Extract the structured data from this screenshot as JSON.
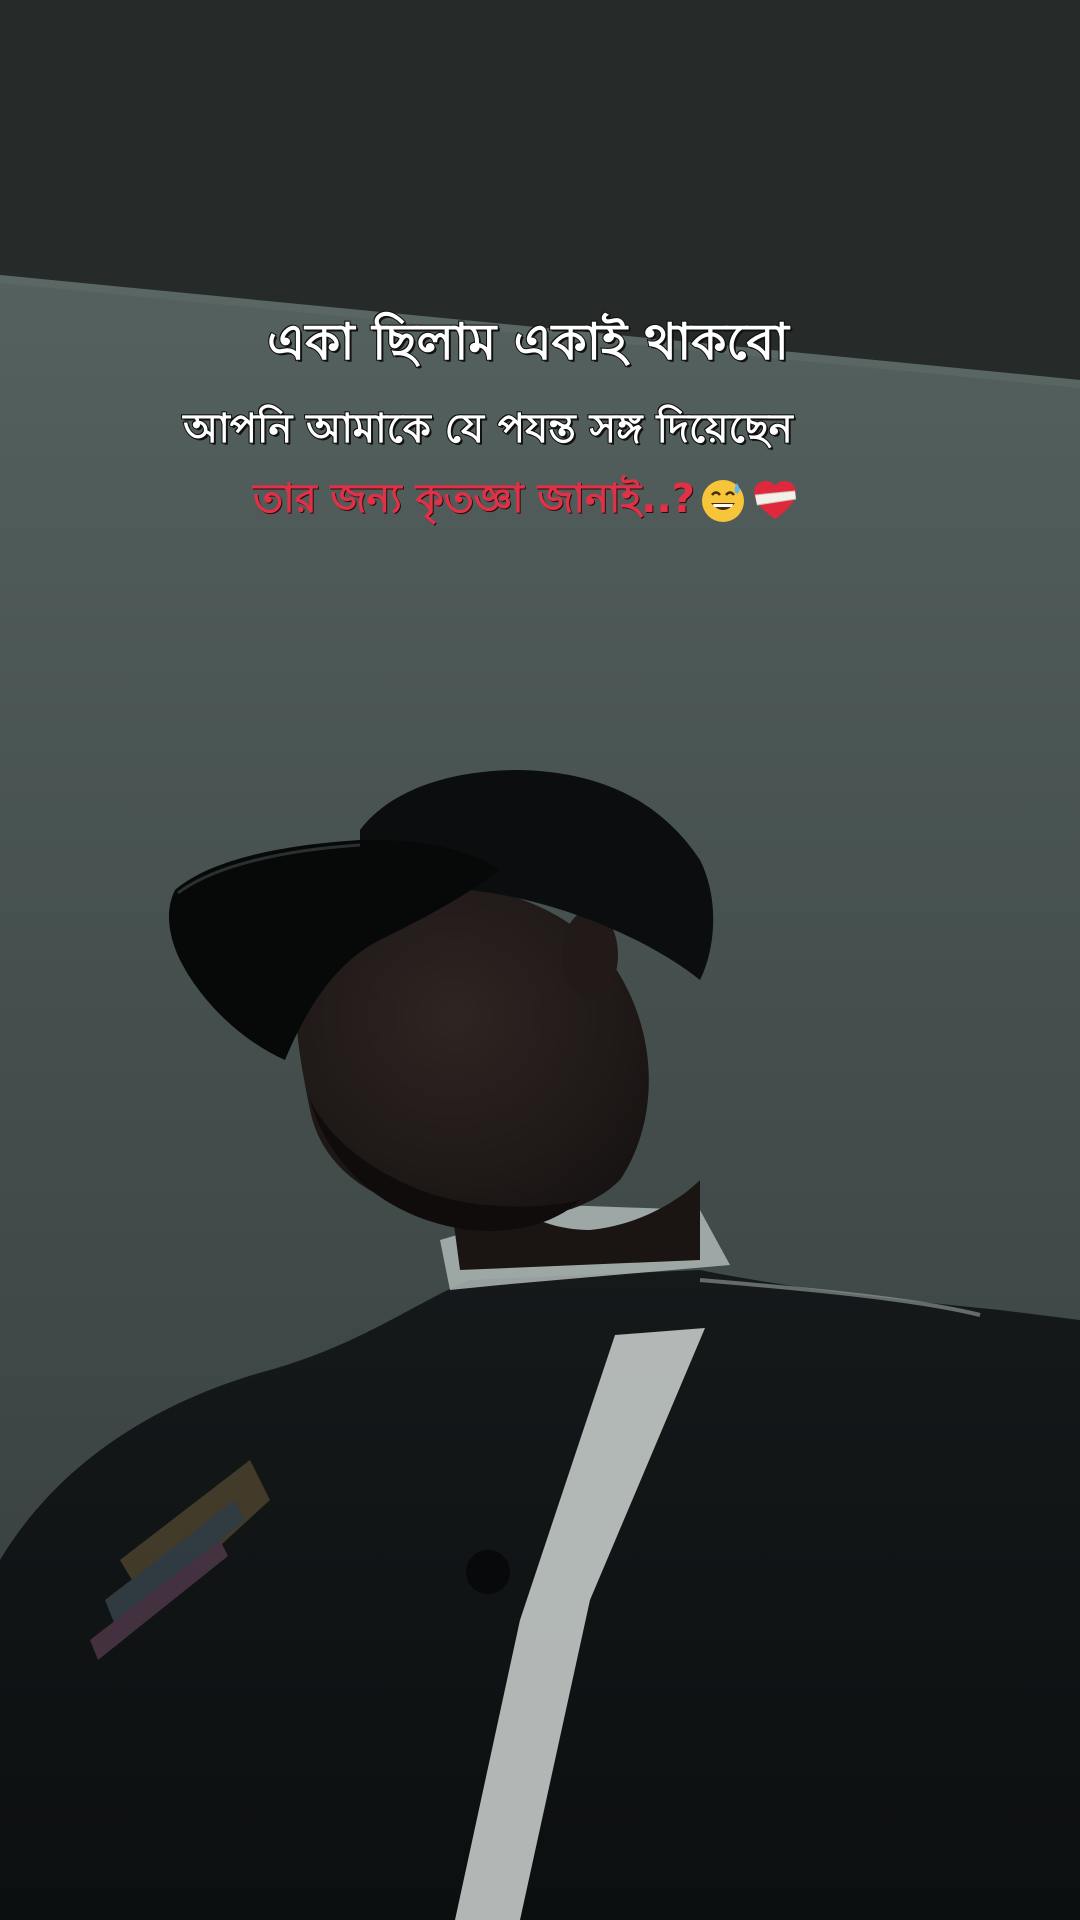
{
  "captions": {
    "line1": "একা ছিলাম একাই থাকবো",
    "line2": "আপনি আমাকে যে পযন্ত সঙ্গ দিয়েছেন",
    "line3": "তার জন্য কৃতজ্ঞা জানাই..?"
  },
  "emojis": [
    "grinning-sweat-emoji",
    "bandaged-heart-emoji"
  ],
  "colors": {
    "caption_white": "#ffffff",
    "caption_red": "#e23046",
    "background": "#3f4a49"
  }
}
